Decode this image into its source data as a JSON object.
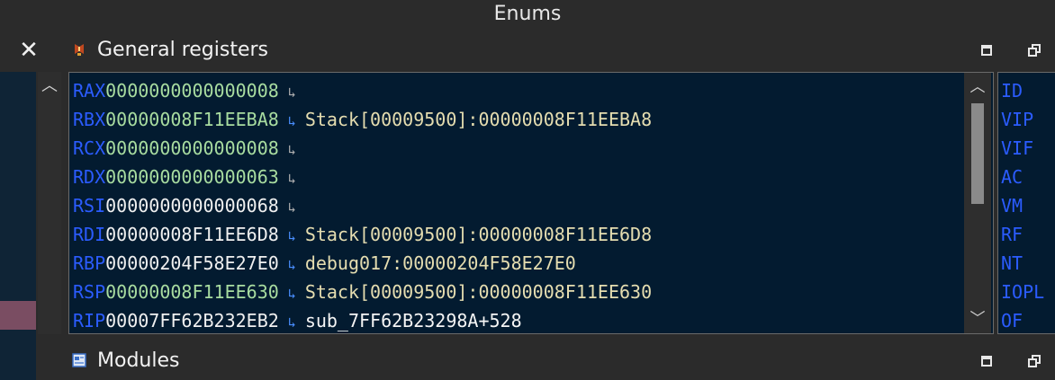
{
  "enums": {
    "title": "Enums"
  },
  "general_registers": {
    "title": "General registers"
  },
  "registers": [
    {
      "name": "RAX",
      "value": "0000000000000008",
      "desc": ""
    },
    {
      "name": "RBX",
      "value": "00000008F11EEBA8",
      "desc": "Stack[00009500]:00000008F11EEBA8"
    },
    {
      "name": "RCX",
      "value": "0000000000000008",
      "desc": ""
    },
    {
      "name": "RDX",
      "value": "0000000000000063",
      "desc": ""
    },
    {
      "name": "RSI",
      "value": "0000000000000068",
      "desc": ""
    },
    {
      "name": "RDI",
      "value": "00000008F11EE6D8",
      "desc": "Stack[00009500]:00000008F11EE6D8"
    },
    {
      "name": "RBP",
      "value": "00000204F58E27E0",
      "desc": "debug017:00000204F58E27E0"
    },
    {
      "name": "RSP",
      "value": "00000008F11EE630",
      "desc": "Stack[00009500]:00000008F11EE630"
    },
    {
      "name": "RIP",
      "value": "00007FF62B232EB2",
      "desc": "sub_7FF62B23298A+528"
    }
  ],
  "flags": [
    "ID",
    "VIP",
    "VIF",
    "AC",
    "VM",
    "RF",
    "NT",
    "IOPL",
    "OF"
  ],
  "modules": {
    "title": "Modules"
  },
  "icons": {
    "close": "close-icon",
    "registers": "registers-icon",
    "modules": "modules-icon",
    "maximize": "maximize-icon",
    "restore": "restore-icon",
    "jump_arrow": "jump-arrow-icon"
  },
  "glyphs": {
    "close": "✕",
    "arrow": "↳",
    "up": "︿",
    "down": "﹀"
  }
}
